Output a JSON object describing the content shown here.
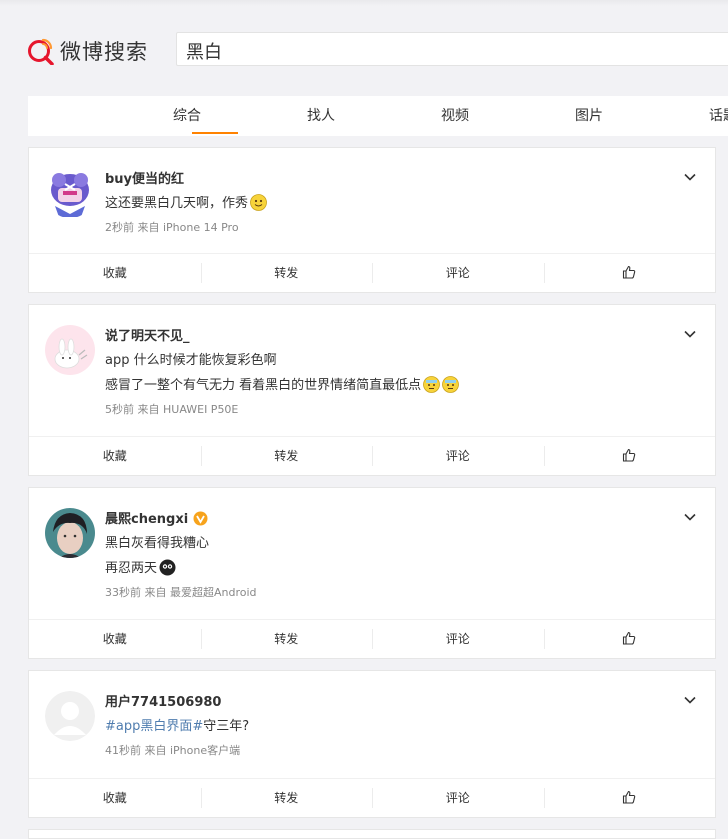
{
  "logo": {
    "text": "微博搜索"
  },
  "search": {
    "value": "黑白"
  },
  "tabs": [
    "综合",
    "找人",
    "视频",
    "图片",
    "话题"
  ],
  "actions": {
    "collect": "收藏",
    "repost": "转发",
    "comment": "评论"
  },
  "posts": [
    {
      "name": "buy便当的红",
      "line1": "这还要黑白几天啊，作秀",
      "meta": "2秒前  来自 iPhone 14 Pro"
    },
    {
      "name": "说了明天不见_",
      "line1": "app 什么时候才能恢复彩色啊",
      "line2": "感冒了一整个有气无力 看着黑白的世界情绪简直最低点",
      "meta": "5秒前  来自 HUAWEI P50E"
    },
    {
      "name": "晨熙chengxi",
      "line1": "黑白灰看得我糟心",
      "line2": "再忍两天",
      "meta": "33秒前  来自 最爱超超Android"
    },
    {
      "name": "用户7741506980",
      "line1_link": "#app黑白界面#",
      "line1_rest": "守三年?",
      "meta": "41秒前  来自 iPhone客户端"
    }
  ],
  "colors": {
    "accent": "#ff8200",
    "link": "#507daf",
    "verified": "#f7a31c"
  }
}
